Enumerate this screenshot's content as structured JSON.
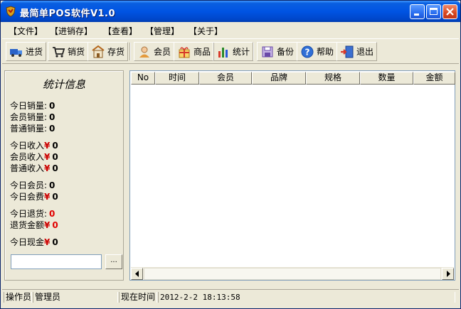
{
  "window": {
    "title": "最简单POS软件V1.0"
  },
  "menu": [
    {
      "label": "【文件】"
    },
    {
      "label": "【进销存】"
    },
    {
      "label": "【查看】"
    },
    {
      "label": "【管理】"
    },
    {
      "label": "【关于】"
    }
  ],
  "toolbar": [
    {
      "label": "进货",
      "icon": "truck-icon"
    },
    {
      "label": "销货",
      "icon": "cart-icon"
    },
    {
      "label": "存货",
      "icon": "warehouse-icon"
    },
    {
      "label": "会员",
      "icon": "member-icon"
    },
    {
      "label": "商品",
      "icon": "gift-icon"
    },
    {
      "label": "统计",
      "icon": "bar-chart-icon"
    },
    {
      "label": "备份",
      "icon": "floppy-icon"
    },
    {
      "label": "帮助",
      "icon": "help-icon"
    },
    {
      "label": "退出",
      "icon": "exit-door-icon"
    }
  ],
  "stats": {
    "title": "统计信息",
    "currency": "¥",
    "today_sales": {
      "label": "今日销量:",
      "value": "0"
    },
    "member_sales": {
      "label": "会员销量:",
      "value": "0"
    },
    "normal_sales": {
      "label": "普通销量:",
      "value": "0"
    },
    "today_income": {
      "label": "今日收入",
      "value": "0"
    },
    "member_income": {
      "label": "会员收入",
      "value": "0"
    },
    "normal_income": {
      "label": "普通收入",
      "value": "0"
    },
    "today_members": {
      "label": "今日会员:",
      "value": "0"
    },
    "today_member_fee": {
      "label": "今日会费",
      "value": "0"
    },
    "today_returns": {
      "label": "今日退货:",
      "value": "0"
    },
    "return_amount": {
      "label": "退货金额",
      "value": "0"
    },
    "today_cash": {
      "label": "今日现金",
      "value": "0"
    },
    "input_value": "",
    "browse_label": "..."
  },
  "grid": {
    "columns": [
      "No",
      "时间",
      "会员",
      "品牌",
      "规格",
      "数量",
      "金额"
    ]
  },
  "status": {
    "operator_label": "操作员",
    "operator_value": "管理员",
    "time_label": "现在时间",
    "time_value": "2012-2-2 18:13:58"
  },
  "colors": {
    "titlebar": "#0054e3",
    "face": "#ece9d8",
    "currency_red": "#cc0000",
    "returns_red": "#e00000"
  }
}
